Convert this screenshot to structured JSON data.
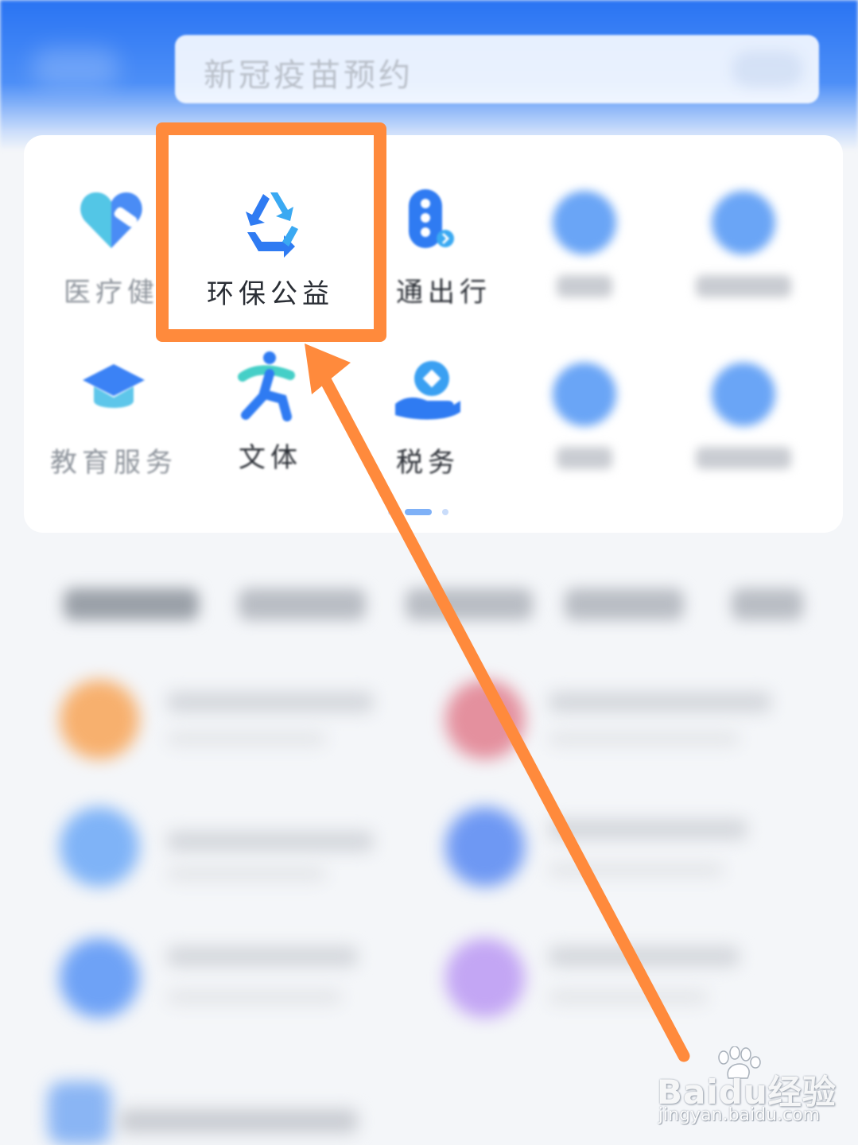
{
  "search": {
    "placeholder": "新冠疫苗预约"
  },
  "services": [
    {
      "label": "医疗健康",
      "icon": "medical-heart-icon"
    },
    {
      "label": "环保公益",
      "icon": "recycle-icon"
    },
    {
      "label": "交通出行",
      "icon": "traffic-light-icon"
    },
    {
      "label": "教育服务",
      "icon": "graduation-cap-icon"
    },
    {
      "label": "文体",
      "icon": "running-person-icon"
    },
    {
      "label": "税务",
      "icon": "tax-hand-coin-icon"
    }
  ],
  "visible_labels": {
    "medical": "医疗健",
    "traffic": "通出行"
  },
  "colors": {
    "accent": "#2a74f3",
    "highlight": "#ff8a3c"
  },
  "watermark": {
    "main": "Baidu经验",
    "sub": "jingyan.baidu.com"
  }
}
